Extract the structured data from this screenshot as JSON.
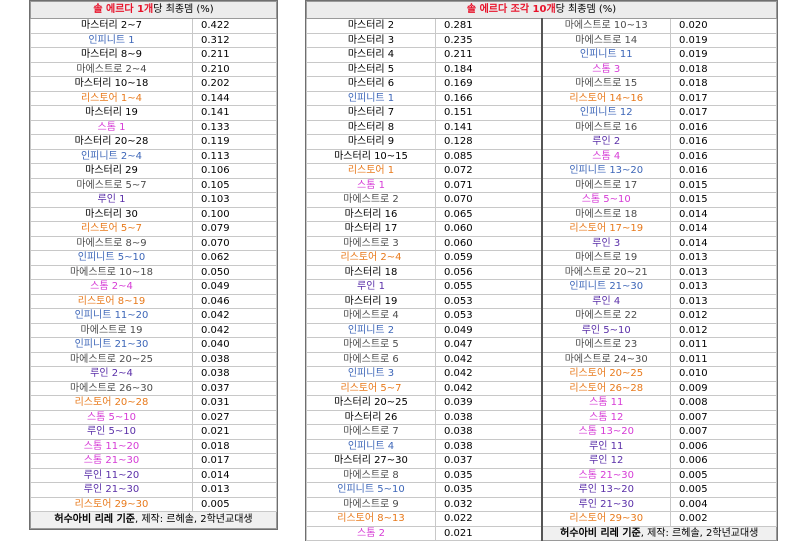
{
  "colors": {
    "mastery": "#000000",
    "infinity": "#3d66b8",
    "maestro": "#4d4d4d",
    "restore": "#e87a1c",
    "storm": "#d63bd6",
    "ruin": "#5a2fa8",
    "header_red": "#e8132b"
  },
  "left": {
    "header": {
      "red": "솔 에르다 1개",
      "rest": "당 최종뎀 (%)"
    },
    "rows": [
      {
        "name": "마스터리 2~7",
        "value": "0.422",
        "cat": "mastery"
      },
      {
        "name": "인피니트 1",
        "value": "0.312",
        "cat": "infinity"
      },
      {
        "name": "마스터리 8~9",
        "value": "0.211",
        "cat": "mastery"
      },
      {
        "name": "마에스트로 2~4",
        "value": "0.210",
        "cat": "maestro"
      },
      {
        "name": "마스터리 10~18",
        "value": "0.202",
        "cat": "mastery"
      },
      {
        "name": "리스토어 1~4",
        "value": "0.144",
        "cat": "restore"
      },
      {
        "name": "마스터리 19",
        "value": "0.141",
        "cat": "mastery"
      },
      {
        "name": "스톰 1",
        "value": "0.133",
        "cat": "storm"
      },
      {
        "name": "마스터리 20~28",
        "value": "0.119",
        "cat": "mastery"
      },
      {
        "name": "인피니트 2~4",
        "value": "0.113",
        "cat": "infinity"
      },
      {
        "name": "마스터리 29",
        "value": "0.106",
        "cat": "mastery"
      },
      {
        "name": "마에스트로 5~7",
        "value": "0.105",
        "cat": "maestro"
      },
      {
        "name": "루인 1",
        "value": "0.103",
        "cat": "ruin"
      },
      {
        "name": "마스터리 30",
        "value": "0.100",
        "cat": "mastery"
      },
      {
        "name": "리스토어 5~7",
        "value": "0.079",
        "cat": "restore"
      },
      {
        "name": "마에스트로 8~9",
        "value": "0.070",
        "cat": "maestro"
      },
      {
        "name": "인피니트 5~10",
        "value": "0.062",
        "cat": "infinity"
      },
      {
        "name": "마에스트로 10~18",
        "value": "0.050",
        "cat": "maestro"
      },
      {
        "name": "스톰 2~4",
        "value": "0.049",
        "cat": "storm"
      },
      {
        "name": "리스토어 8~19",
        "value": "0.046",
        "cat": "restore"
      },
      {
        "name": "인피니트 11~20",
        "value": "0.042",
        "cat": "infinity"
      },
      {
        "name": "마에스트로 19",
        "value": "0.042",
        "cat": "maestro"
      },
      {
        "name": "인피니트 21~30",
        "value": "0.040",
        "cat": "infinity"
      },
      {
        "name": "마에스트로 20~25",
        "value": "0.038",
        "cat": "maestro"
      },
      {
        "name": "루인 2~4",
        "value": "0.038",
        "cat": "ruin"
      },
      {
        "name": "마에스트로 26~30",
        "value": "0.037",
        "cat": "maestro"
      },
      {
        "name": "리스토어 20~28",
        "value": "0.031",
        "cat": "restore"
      },
      {
        "name": "스톰 5~10",
        "value": "0.027",
        "cat": "storm"
      },
      {
        "name": "루인 5~10",
        "value": "0.021",
        "cat": "ruin"
      },
      {
        "name": "스톰 11~20",
        "value": "0.018",
        "cat": "storm"
      },
      {
        "name": "스톰 21~30",
        "value": "0.017",
        "cat": "storm"
      },
      {
        "name": "루인 11~20",
        "value": "0.014",
        "cat": "ruin"
      },
      {
        "name": "루인 21~30",
        "value": "0.013",
        "cat": "ruin"
      },
      {
        "name": "리스토어 29~30",
        "value": "0.005",
        "cat": "restore"
      }
    ],
    "footer": {
      "bold": "허수아비 리레 기준",
      "rest": ", 제작: 르헤솔, 2학년교대생"
    }
  },
  "right": {
    "header": {
      "red": "솔 에르다 조각 10개",
      "rest": "당 최종뎀 (%)"
    },
    "col1": [
      {
        "name": "마스터리 2",
        "value": "0.281",
        "cat": "mastery"
      },
      {
        "name": "마스터리 3",
        "value": "0.235",
        "cat": "mastery"
      },
      {
        "name": "마스터리 4",
        "value": "0.211",
        "cat": "mastery"
      },
      {
        "name": "마스터리 5",
        "value": "0.184",
        "cat": "mastery"
      },
      {
        "name": "마스터리 6",
        "value": "0.169",
        "cat": "mastery"
      },
      {
        "name": "인피니트 1",
        "value": "0.166",
        "cat": "infinity"
      },
      {
        "name": "마스터리 7",
        "value": "0.151",
        "cat": "mastery"
      },
      {
        "name": "마스터리 8",
        "value": "0.141",
        "cat": "mastery"
      },
      {
        "name": "마스터리 9",
        "value": "0.128",
        "cat": "mastery"
      },
      {
        "name": "마스터리 10~15",
        "value": "0.085",
        "cat": "mastery"
      },
      {
        "name": "리스토어 1",
        "value": "0.072",
        "cat": "restore"
      },
      {
        "name": "스톰 1",
        "value": "0.071",
        "cat": "storm"
      },
      {
        "name": "마에스트로 2",
        "value": "0.070",
        "cat": "maestro"
      },
      {
        "name": "마스터리 16",
        "value": "0.065",
        "cat": "mastery"
      },
      {
        "name": "마스터리 17",
        "value": "0.060",
        "cat": "mastery"
      },
      {
        "name": "마에스트로 3",
        "value": "0.060",
        "cat": "maestro"
      },
      {
        "name": "리스토어 2~4",
        "value": "0.059",
        "cat": "restore"
      },
      {
        "name": "마스터리 18",
        "value": "0.056",
        "cat": "mastery"
      },
      {
        "name": "루인 1",
        "value": "0.055",
        "cat": "ruin"
      },
      {
        "name": "마스터리 19",
        "value": "0.053",
        "cat": "mastery"
      },
      {
        "name": "마에스트로 4",
        "value": "0.053",
        "cat": "maestro"
      },
      {
        "name": "인피니트 2",
        "value": "0.049",
        "cat": "infinity"
      },
      {
        "name": "마에스트로 5",
        "value": "0.047",
        "cat": "maestro"
      },
      {
        "name": "마에스트로 6",
        "value": "0.042",
        "cat": "maestro"
      },
      {
        "name": "인피니트 3",
        "value": "0.042",
        "cat": "infinity"
      },
      {
        "name": "리스토어 5~7",
        "value": "0.042",
        "cat": "restore"
      },
      {
        "name": "마스터리 20~25",
        "value": "0.039",
        "cat": "mastery"
      },
      {
        "name": "마스터리 26",
        "value": "0.038",
        "cat": "mastery"
      },
      {
        "name": "마에스트로 7",
        "value": "0.038",
        "cat": "maestro"
      },
      {
        "name": "인피니트 4",
        "value": "0.038",
        "cat": "infinity"
      },
      {
        "name": "마스터리 27~30",
        "value": "0.037",
        "cat": "mastery"
      },
      {
        "name": "마에스트로 8",
        "value": "0.035",
        "cat": "maestro"
      },
      {
        "name": "인피니트 5~10",
        "value": "0.035",
        "cat": "infinity"
      },
      {
        "name": "마에스트로 9",
        "value": "0.032",
        "cat": "maestro"
      },
      {
        "name": "리스토어 8~13",
        "value": "0.022",
        "cat": "restore"
      },
      {
        "name": "스톰 2",
        "value": "0.021",
        "cat": "storm"
      }
    ],
    "col2": [
      {
        "name": "마에스트로 10~13",
        "value": "0.020",
        "cat": "maestro"
      },
      {
        "name": "마에스트로 14",
        "value": "0.019",
        "cat": "maestro"
      },
      {
        "name": "인피니트 11",
        "value": "0.019",
        "cat": "infinity"
      },
      {
        "name": "스톰 3",
        "value": "0.018",
        "cat": "storm"
      },
      {
        "name": "마에스트로 15",
        "value": "0.018",
        "cat": "maestro"
      },
      {
        "name": "리스토어 14~16",
        "value": "0.017",
        "cat": "restore"
      },
      {
        "name": "인피니트 12",
        "value": "0.017",
        "cat": "infinity"
      },
      {
        "name": "마에스트로 16",
        "value": "0.016",
        "cat": "maestro"
      },
      {
        "name": "루인 2",
        "value": "0.016",
        "cat": "ruin"
      },
      {
        "name": "스톰 4",
        "value": "0.016",
        "cat": "storm"
      },
      {
        "name": "인피니트 13~20",
        "value": "0.016",
        "cat": "infinity"
      },
      {
        "name": "마에스트로 17",
        "value": "0.015",
        "cat": "maestro"
      },
      {
        "name": "스톰 5~10",
        "value": "0.015",
        "cat": "storm"
      },
      {
        "name": "마에스트로 18",
        "value": "0.014",
        "cat": "maestro"
      },
      {
        "name": "리스토어 17~19",
        "value": "0.014",
        "cat": "restore"
      },
      {
        "name": "루인 3",
        "value": "0.014",
        "cat": "ruin"
      },
      {
        "name": "마에스트로 19",
        "value": "0.013",
        "cat": "maestro"
      },
      {
        "name": "마에스트로 20~21",
        "value": "0.013",
        "cat": "maestro"
      },
      {
        "name": "인피니트 21~30",
        "value": "0.013",
        "cat": "infinity"
      },
      {
        "name": "루인 4",
        "value": "0.013",
        "cat": "ruin"
      },
      {
        "name": "마에스트로 22",
        "value": "0.012",
        "cat": "maestro"
      },
      {
        "name": "루인 5~10",
        "value": "0.012",
        "cat": "ruin"
      },
      {
        "name": "마에스트로 23",
        "value": "0.011",
        "cat": "maestro"
      },
      {
        "name": "마에스트로 24~30",
        "value": "0.011",
        "cat": "maestro"
      },
      {
        "name": "리스토어 20~25",
        "value": "0.010",
        "cat": "restore"
      },
      {
        "name": "리스토어 26~28",
        "value": "0.009",
        "cat": "restore"
      },
      {
        "name": "스톰 11",
        "value": "0.008",
        "cat": "storm"
      },
      {
        "name": "스톰 12",
        "value": "0.007",
        "cat": "storm"
      },
      {
        "name": "스톰 13~20",
        "value": "0.007",
        "cat": "storm"
      },
      {
        "name": "루인 11",
        "value": "0.006",
        "cat": "ruin"
      },
      {
        "name": "루인 12",
        "value": "0.006",
        "cat": "ruin"
      },
      {
        "name": "스톰 21~30",
        "value": "0.005",
        "cat": "storm"
      },
      {
        "name": "루인 13~20",
        "value": "0.005",
        "cat": "ruin"
      },
      {
        "name": "루인 21~30",
        "value": "0.004",
        "cat": "ruin"
      },
      {
        "name": "리스토어 29~30",
        "value": "0.002",
        "cat": "restore"
      }
    ],
    "footer": {
      "bold": "허수아비 리레 기준",
      "rest": ", 제작: 르헤솔, 2학년교대생"
    }
  }
}
